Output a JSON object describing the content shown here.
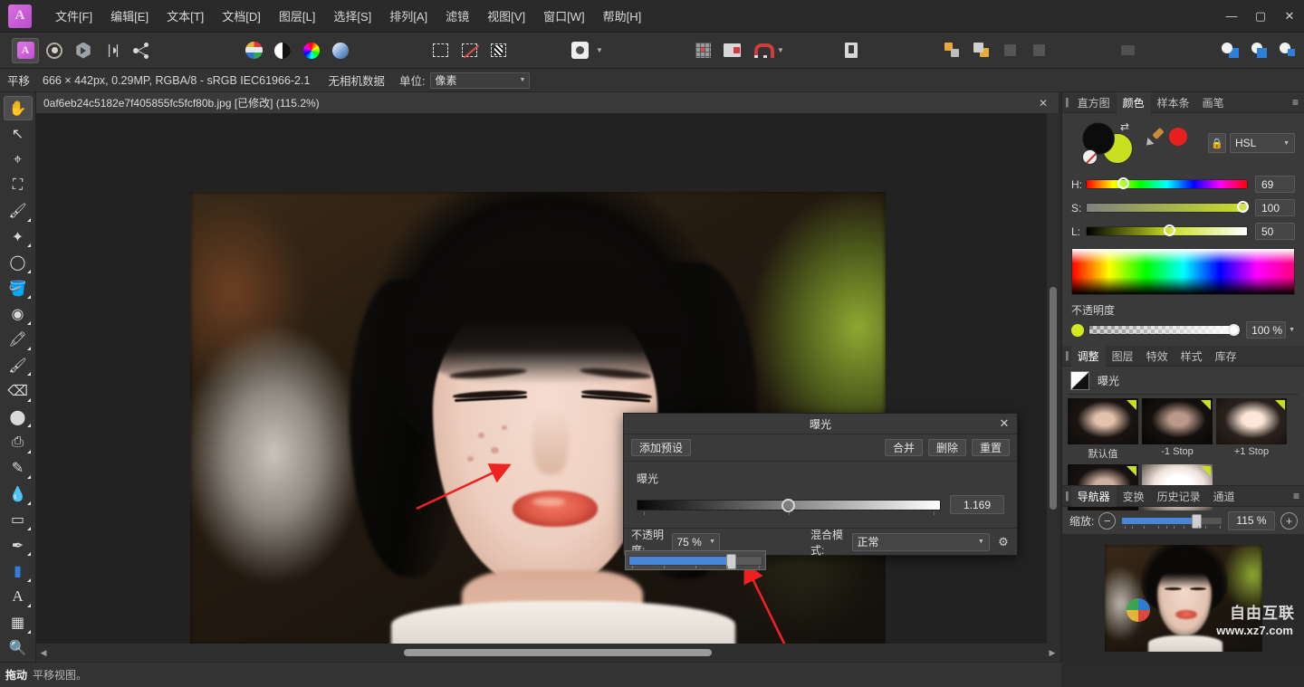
{
  "app": {
    "logo_glyph": "A",
    "window_controls": {
      "minimize": "—",
      "maximize": "▢",
      "close": "✕"
    }
  },
  "menu": {
    "items": [
      {
        "label": "文件[F]"
      },
      {
        "label": "编辑[E]"
      },
      {
        "label": "文本[T]"
      },
      {
        "label": "文档[D]"
      },
      {
        "label": "图层[L]"
      },
      {
        "label": "选择[S]"
      },
      {
        "label": "排列[A]"
      },
      {
        "label": "滤镜"
      },
      {
        "label": "视图[V]"
      },
      {
        "label": "窗口[W]"
      },
      {
        "label": "帮助[H]"
      }
    ]
  },
  "toolbar": {
    "personas": [
      "photo-persona-icon",
      "liquify-persona-icon",
      "develop-persona-icon",
      "tone-mapping-icon",
      "export-persona-icon"
    ],
    "color_tools": [
      "channels-icon",
      "contrast-icon",
      "color-wheel-icon",
      "gradient-icon"
    ],
    "selection_tools": [
      "marquee-icon",
      "deselect-icon",
      "refine-selection-icon"
    ],
    "mask_tool": "mask-icon",
    "view_tools": [
      "grid-icon",
      "snapping-icon",
      "magnet-icon"
    ],
    "history_tool": "delete-icon",
    "arrange_tools": [
      "move-front-icon",
      "move-back-icon",
      "align-h-icon",
      "align-v-icon"
    ],
    "distribute_tool": "distribute-icon",
    "boolean_tools": [
      "add-shape-icon",
      "subtract-shape-icon",
      "intersect-shape-icon"
    ]
  },
  "context_bar": {
    "tool_name": "平移",
    "doc_info": "666 × 442px, 0.29MP, RGBA/8 - sRGB IEC61966-2.1",
    "camera_data": "无相机数据",
    "unit_label": "单位:",
    "unit_value": "像素"
  },
  "tools_palette": {
    "items": [
      {
        "name": "pan-tool",
        "glyph": "✋",
        "active": true,
        "has_flyout": false
      },
      {
        "name": "move-tool",
        "glyph": "↖",
        "active": false,
        "has_flyout": false
      },
      {
        "name": "color-picker-tool",
        "glyph": "⌖",
        "active": false,
        "has_flyout": false
      },
      {
        "name": "crop-tool",
        "glyph": "⛶",
        "active": false,
        "has_flyout": false
      },
      {
        "name": "retouch-tool",
        "glyph": "🖌",
        "active": false,
        "has_flyout": true
      },
      {
        "name": "magic-wand-tool",
        "glyph": "✦",
        "active": false,
        "has_flyout": true
      },
      {
        "name": "lasso-tool",
        "glyph": "◯",
        "active": false,
        "has_flyout": true
      },
      {
        "name": "flood-fill-tool",
        "glyph": "🪣",
        "active": false,
        "has_flyout": true
      },
      {
        "name": "color-replace-tool",
        "glyph": "◉",
        "active": false,
        "has_flyout": true
      },
      {
        "name": "paint-brush-tool",
        "glyph": "🖍",
        "active": false,
        "has_flyout": true
      },
      {
        "name": "smudge-tool",
        "glyph": "🖌",
        "active": false,
        "has_flyout": true
      },
      {
        "name": "eraser-tool",
        "glyph": "⌫",
        "active": false,
        "has_flyout": true
      },
      {
        "name": "dodge-burn-tool",
        "glyph": "⬤",
        "active": false,
        "has_flyout": true
      },
      {
        "name": "clone-stamp-tool",
        "glyph": "⎙",
        "active": false,
        "has_flyout": true
      },
      {
        "name": "healing-brush-tool",
        "glyph": "✎",
        "active": false,
        "has_flyout": true
      },
      {
        "name": "blur-tool",
        "glyph": "💧",
        "active": false,
        "has_flyout": true
      },
      {
        "name": "patch-tool",
        "glyph": "▭",
        "active": false,
        "has_flyout": true
      },
      {
        "name": "pen-tool",
        "glyph": "✒",
        "active": false,
        "has_flyout": true
      },
      {
        "name": "rectangle-tool",
        "glyph": "▮",
        "active": false,
        "has_flyout": true
      },
      {
        "name": "text-tool",
        "glyph": "A",
        "active": false,
        "has_flyout": true
      },
      {
        "name": "mesh-warp-tool",
        "glyph": "▦",
        "active": false,
        "has_flyout": true
      },
      {
        "name": "zoom-tool",
        "glyph": "🔍",
        "active": false,
        "has_flyout": false
      }
    ]
  },
  "document_tab": {
    "title": "0af6eb24c5182e7f405855fc5fcf80b.jpg [已修改] (115.2%)",
    "close_glyph": "✕"
  },
  "exposure_dialog": {
    "title": "曝光",
    "close_glyph": "✕",
    "add_preset": "添加预设",
    "merge": "合并",
    "delete": "删除",
    "reset": "重置",
    "slider_label": "曝光",
    "slider_value": "1.169",
    "opacity_label": "不透明度:",
    "opacity_value": "75 %",
    "blend_label": "混合模式:",
    "blend_value": "正常",
    "gear_glyph": "⚙",
    "caret_glyph": "▼"
  },
  "color_panel": {
    "tabs": [
      {
        "label": "直方图",
        "active": false
      },
      {
        "label": "颜色",
        "active": true
      },
      {
        "label": "样本条",
        "active": false
      },
      {
        "label": "画笔",
        "active": false
      }
    ],
    "menu_glyph": "≡",
    "mode": "HSL",
    "lock_glyph": "🔒",
    "sliders": [
      {
        "label": "H:",
        "value": "69",
        "pos": 23
      },
      {
        "label": "S:",
        "value": "100",
        "pos": 97
      },
      {
        "label": "L:",
        "value": "50",
        "pos": 50
      }
    ],
    "opacity_title": "不透明度",
    "opacity_value": "100 %",
    "front_color": "#0c0c0c",
    "back_color": "#c9e021",
    "accent_red": "#e81f1f"
  },
  "adjust_panel": {
    "tabs": [
      {
        "label": "调整",
        "active": true
      },
      {
        "label": "图层",
        "active": false
      },
      {
        "label": "特效",
        "active": false
      },
      {
        "label": "样式",
        "active": false
      },
      {
        "label": "库存",
        "active": false
      }
    ],
    "current_adjustment": "曝光",
    "presets": [
      {
        "label": "默认值"
      },
      {
        "label": "-1 Stop"
      },
      {
        "label": "+1 Stop"
      },
      {
        "label": ""
      },
      {
        "label": ""
      }
    ]
  },
  "navigator_panel": {
    "tabs": [
      {
        "label": "导航器",
        "active": true
      },
      {
        "label": "变换",
        "active": false
      },
      {
        "label": "历史记录",
        "active": false
      },
      {
        "label": "通道",
        "active": false
      }
    ],
    "menu_glyph": "≡",
    "zoom_label": "缩放:",
    "zoom_value": "115 %",
    "minus_glyph": "−",
    "plus_glyph": "+"
  },
  "status_bar": {
    "key": "拖动",
    "text": "平移视图。"
  },
  "watermark": {
    "brand": "自由互联",
    "url": "www.xz7.com"
  },
  "scrollbars": {
    "left_arrow": "◀",
    "right_arrow": "▶"
  }
}
